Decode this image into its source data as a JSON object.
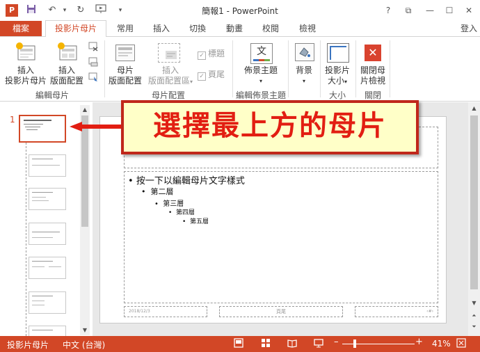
{
  "app": {
    "logo": "P",
    "title": "簡報1 - PowerPoint",
    "window_controls": {
      "help": "?",
      "restore_ribbon": "⧉",
      "minimize": "—",
      "maximize": "☐",
      "close": "✕"
    },
    "login": "登入"
  },
  "quick_access": [
    "save-icon",
    "undo-icon",
    "redo-icon",
    "start-from-beginning-icon",
    "customize-icon"
  ],
  "tabs": {
    "file": "檔案",
    "items": [
      "投影片母片",
      "常用",
      "插入",
      "切換",
      "動畫",
      "校閱",
      "檢視"
    ],
    "active": "投影片母片"
  },
  "ribbon": {
    "insert_master": "插入\n投影片母片",
    "insert_master_l1": "插入",
    "insert_master_l2": "投影片母片",
    "insert_layout_l1": "插入",
    "insert_layout_l2": "版面配置",
    "group_edit_master": "編輯母片",
    "master_layout_l1": "母片",
    "master_layout_l2": "版面配置",
    "insert_placeholder_l1": "插入",
    "insert_placeholder_l2": "版面配置區",
    "chk_title": "標題",
    "chk_footer": "頁尾",
    "group_master_layout": "母片配置",
    "theme_label": "佈景主題",
    "theme_icon_text": "文",
    "group_edit_theme": "編輯佈景主題",
    "background_label": "背景",
    "slide_size_l1": "投影片",
    "slide_size_l2": "大小",
    "group_size": "大小",
    "close_l1": "關閉母",
    "close_l2": "片檢視",
    "group_close": "關閉"
  },
  "thumbnails": {
    "first_number": "1"
  },
  "slide": {
    "bullets": [
      {
        "level": 1,
        "text": "按一下以編輯母片文字樣式"
      },
      {
        "level": 2,
        "text": "第二層"
      },
      {
        "level": 3,
        "text": "第三層"
      },
      {
        "level": 4,
        "text": "第四層"
      },
      {
        "level": 5,
        "text": "第五層"
      }
    ],
    "footer_date": "2018/12/3",
    "footer_text": "頁尾",
    "footer_num": "‹#›"
  },
  "callout": {
    "text": "選擇最上方的母片",
    "color": "#e21e12"
  },
  "status": {
    "view": "投影片母片",
    "language": "中文 (台灣)",
    "zoom": "41%",
    "zoom_fraction": 0.41
  },
  "colors": {
    "accent": "#d24726",
    "callout_border": "#c0271b",
    "callout_bg": "#ffffc8"
  }
}
